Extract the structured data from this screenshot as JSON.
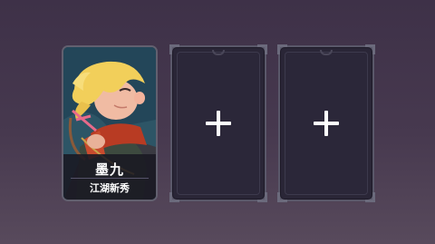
{
  "slots": [
    {
      "state": "filled",
      "hero_name": "墨九",
      "hero_title": "江湖新秀",
      "portrait": "blonde-archer-portrait"
    },
    {
      "state": "empty",
      "icon": "plus-icon"
    },
    {
      "state": "empty",
      "icon": "plus-icon"
    }
  ],
  "colors": {
    "background": "#45384e",
    "slot_fill": "#2a2637",
    "slot_border": "#5a586a",
    "plus": "#ffffff"
  }
}
